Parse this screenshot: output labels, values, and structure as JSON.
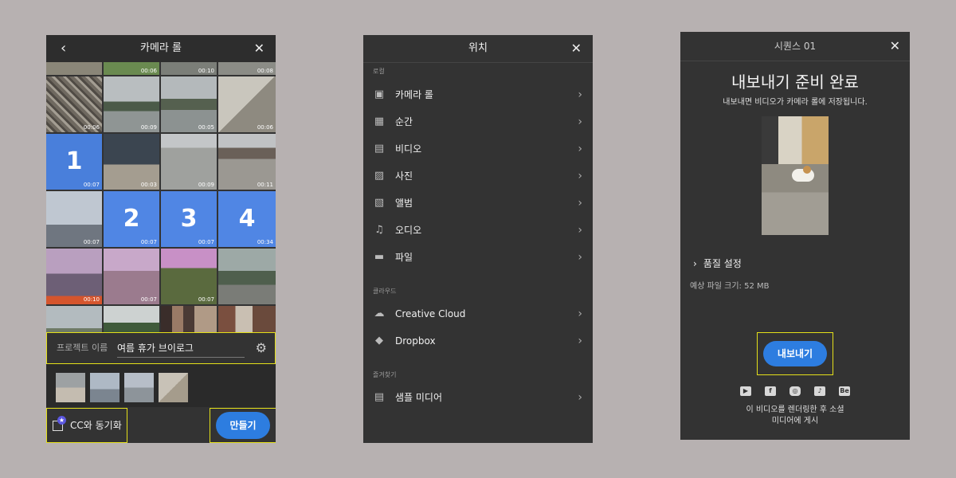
{
  "camera_roll": {
    "title": "카메라 롤",
    "thumbs": [
      {
        "dur": "00:06"
      },
      {
        "dur": "00:09"
      },
      {
        "dur": "00:05"
      },
      {
        "dur": "00:06"
      },
      {
        "dur": "00:07",
        "sel": "1"
      },
      {
        "dur": "00:03"
      },
      {
        "dur": "00:09"
      },
      {
        "dur": "00:11"
      },
      {
        "dur": "00:07"
      },
      {
        "dur": "00:07",
        "sel": "2"
      },
      {
        "dur": "00:07",
        "sel": "3"
      },
      {
        "dur": "00:34",
        "sel": "4"
      },
      {
        "dur": "00:10"
      },
      {
        "dur": "00:07"
      },
      {
        "dur": "00:07"
      },
      {
        "dur": ""
      }
    ],
    "top_strip_durations": [
      "00:06",
      "00:10",
      "00:08"
    ],
    "project_label": "프로젝트 이름",
    "project_name": "여름 휴가 브이로그",
    "sync_label": "CC와 동기화",
    "create_label": "만들기"
  },
  "location": {
    "title": "위치",
    "local_header": "로컬",
    "local_items": [
      {
        "label": "카메라 롤",
        "icon": "camera-roll-icon"
      },
      {
        "label": "순간",
        "icon": "calendar-icon"
      },
      {
        "label": "비디오",
        "icon": "film-icon"
      },
      {
        "label": "사진",
        "icon": "image-icon"
      },
      {
        "label": "앨범",
        "icon": "album-icon"
      },
      {
        "label": "오디오",
        "icon": "music-icon"
      },
      {
        "label": "파일",
        "icon": "folder-icon"
      }
    ],
    "cloud_header": "클라우드",
    "cloud_items": [
      {
        "label": "Creative Cloud",
        "icon": "creative-cloud-icon"
      },
      {
        "label": "Dropbox",
        "icon": "dropbox-icon"
      }
    ],
    "fav_header": "즐겨찾기",
    "fav_items": [
      {
        "label": "샘플 미디어",
        "icon": "film-icon"
      }
    ]
  },
  "export": {
    "title": "시퀀스 01",
    "heading": "내보내기 준비 완료",
    "subtext": "내보내면 비디오가 카메라 롤에 저장됩니다.",
    "quality_label": "품질 설정",
    "file_size": "예상 파일 크기: 52 MB",
    "export_button": "내보내기",
    "social_icons": [
      "youtube-icon",
      "facebook-icon",
      "instagram-icon",
      "tiktok-icon",
      "behance-icon"
    ],
    "social_labels": {
      "behance": "Be"
    },
    "post_text_1": "이 비디오를 렌더링한 후 소셜",
    "post_text_2": "미디어에 게시"
  },
  "colors": {
    "accent": "#2d7de0",
    "highlight": "#e4e01a",
    "panel": "#333333",
    "background": "#b7b1b1"
  }
}
